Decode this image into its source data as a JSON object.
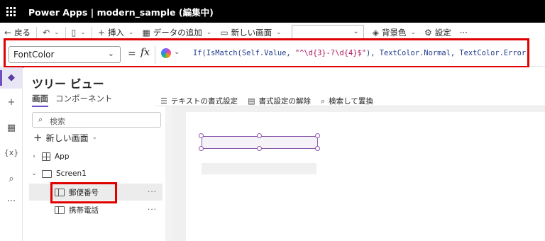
{
  "titlebar": {
    "title": "Power Apps | modern_sample (編集中)"
  },
  "commandbar": {
    "back": "戻る",
    "insert": "挿入",
    "add_data": "データの追加",
    "new_screen": "新しい画面",
    "background": "背景色",
    "settings": "設定",
    "more": "···"
  },
  "formulabar": {
    "property": "FontColor",
    "equals": "=",
    "fx": "fx",
    "formula_parts": {
      "p1": "If(IsMatch(Self.Value, ",
      "p2": "\"^\\d{3}-?\\d{4}$\"",
      "p3": "), TextColor.Normal, TextColor.Error)"
    }
  },
  "tree": {
    "title": "ツリー ビュー",
    "tabs": [
      "画面",
      "コンポーネント"
    ],
    "search_placeholder": "検索",
    "new_screen": "新しい画面",
    "nodes": [
      {
        "label": "App"
      },
      {
        "label": "Screen1"
      },
      {
        "label": "郵便番号"
      },
      {
        "label": "携帯電話"
      }
    ],
    "more": "···"
  },
  "formatbar": {
    "text_format": "テキストの書式設定",
    "clear_format": "書式設定の解除",
    "find_replace": "検索して置換"
  },
  "colors": {
    "highlight": "#e00000",
    "accent": "#6d4fc2"
  },
  "icons": [
    "waffle-icon",
    "back-arrow-icon",
    "undo-icon",
    "paste-icon",
    "plus-icon",
    "table-icon",
    "screen-icon",
    "paint-icon",
    "gear-icon",
    "copilot-icon",
    "search-icon",
    "layers-icon",
    "variable-icon"
  ]
}
